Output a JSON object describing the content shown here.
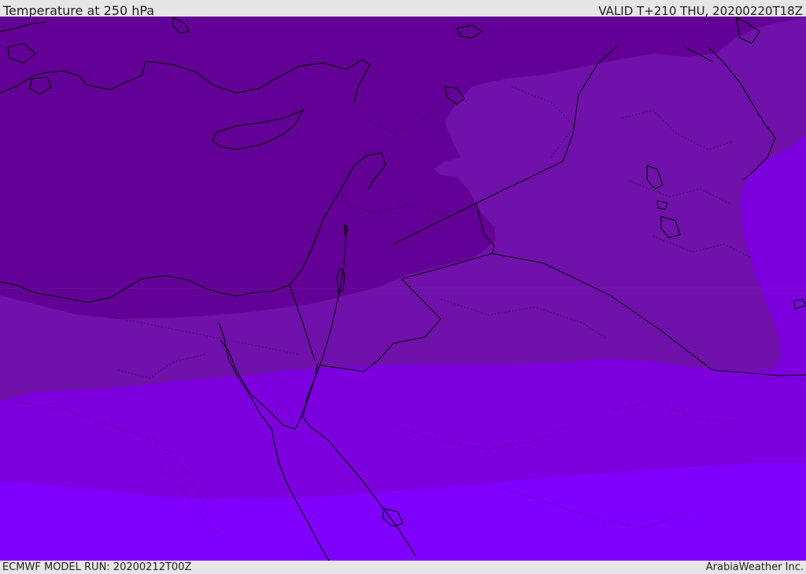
{
  "header": {
    "title": "Temperature at 250 hPa",
    "valid": "VALID T+210 THU, 20200220T18Z"
  },
  "footer": {
    "model_run": "ECMWF MODEL RUN: 20200212T00Z",
    "credit": "ArabiaWeather Inc."
  },
  "map": {
    "variable": "temperature",
    "level": "250 hPa",
    "region": "Eastern Mediterranean / Middle East",
    "colors": {
      "band_darkest": "#630096",
      "band_dark": "#7011ab",
      "band_mid": "#7d00de",
      "band_light": "#8000ff",
      "coastline": "#000000",
      "border": "#000000"
    }
  }
}
